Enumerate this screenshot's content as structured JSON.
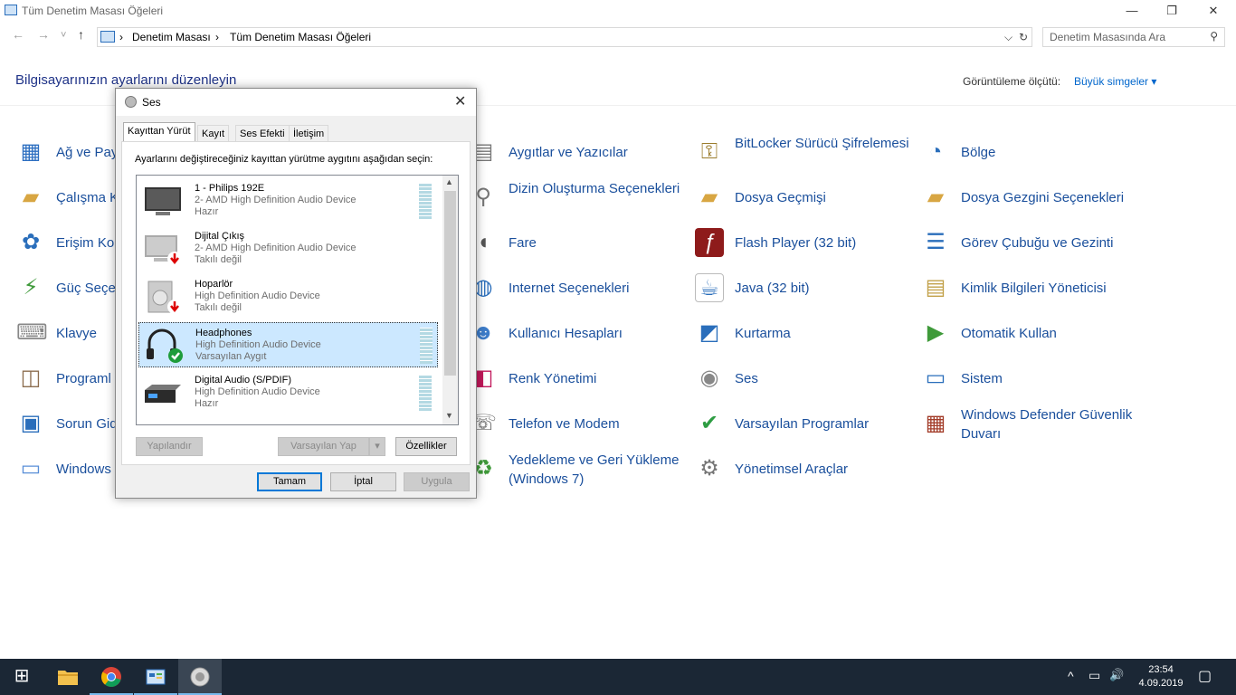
{
  "window": {
    "title": "Tüm Denetim Masası Öğeleri",
    "minimize": "—",
    "maximize": "❐",
    "close": "✕"
  },
  "nav": {
    "back": "←",
    "forward": "→",
    "recent": "˅",
    "up": "↑"
  },
  "address": {
    "sep": "›",
    "crumb1": "Denetim Masası",
    "crumb2": "Tüm Denetim Masası Öğeleri",
    "dropdown": "⌵",
    "refresh": "↻"
  },
  "search": {
    "placeholder": "Denetim Masasında Ara",
    "icon": "⚲"
  },
  "header": {
    "title": "Bilgisayarınızın ayarlarını düzenleyin",
    "view_by_label": "Görüntüleme ölçütü:",
    "view_by_value": "Büyük simgeler ▾"
  },
  "items": [
    {
      "label": "Ağ ve Pay",
      "icon": "network-icon",
      "glyph": "▦",
      "color": "#2d6fc1"
    },
    {
      "label": "Çalışma K",
      "icon": "work-folders-icon",
      "glyph": "▰",
      "color": "#d8a642"
    },
    {
      "label": "Erişim Ko",
      "icon": "ease-of-access-icon",
      "glyph": "✿",
      "color": "#2a6ebb"
    },
    {
      "label": "Güç Seçen",
      "icon": "power-options-icon",
      "glyph": "⚡",
      "color": "#3f9a3a"
    },
    {
      "label": "Klavye",
      "icon": "keyboard-icon",
      "glyph": "⌨",
      "color": "#888888"
    },
    {
      "label": "Programl",
      "icon": "programs-icon",
      "glyph": "◫",
      "color": "#8c6d4f"
    },
    {
      "label": "Sorun Gid",
      "icon": "troubleshooting-icon",
      "glyph": "▣",
      "color": "#2a6ebb"
    },
    {
      "label": "Windows",
      "icon": "windows-to-go-icon",
      "glyph": "▭",
      "color": "#5a8fd8"
    },
    {
      "label": "Aygıtlar ve Yazıcılar",
      "icon": "devices-printers-icon",
      "glyph": "▤",
      "color": "#777777"
    },
    {
      "label": "Dizin Oluşturma Seçenekleri",
      "icon": "indexing-icon",
      "glyph": "⚲",
      "color": "#777777"
    },
    {
      "label": "Fare",
      "icon": "mouse-icon",
      "glyph": "◖",
      "color": "#555555"
    },
    {
      "label": "Internet Seçenekleri",
      "icon": "internet-options-icon",
      "glyph": "◍",
      "color": "#2a6ebb"
    },
    {
      "label": "Kullanıcı Hesapları",
      "icon": "user-accounts-icon",
      "glyph": "☻",
      "color": "#3d7cc9"
    },
    {
      "label": "Renk Yönetimi",
      "icon": "color-management-icon",
      "glyph": "◧",
      "color": "#c2185b"
    },
    {
      "label": "Telefon ve Modem",
      "icon": "phone-modem-icon",
      "glyph": "☏",
      "color": "#666666"
    },
    {
      "label": "Yedekleme ve Geri Yükleme (Windows 7)",
      "icon": "backup-restore-icon",
      "glyph": "♻",
      "color": "#3f9a3a"
    },
    {
      "label": "BitLocker Sürücü Şifrelemesi",
      "icon": "bitlocker-icon",
      "glyph": "⚿",
      "color": "#9a7b2a"
    },
    {
      "label": "Dosya Geçmişi",
      "icon": "file-history-icon",
      "glyph": "▰",
      "color": "#d8a642"
    },
    {
      "label": "Flash Player (32 bit)",
      "icon": "flash-player-icon",
      "glyph": "ƒ",
      "color": "#8e1b1b"
    },
    {
      "label": "Java (32 bit)",
      "icon": "java-icon",
      "glyph": "☕",
      "color": "#2a6ebb"
    },
    {
      "label": "Kurtarma",
      "icon": "recovery-icon",
      "glyph": "◩",
      "color": "#2a6ebb"
    },
    {
      "label": "Ses",
      "icon": "sound-icon",
      "glyph": "◉",
      "color": "#888888"
    },
    {
      "label": "Varsayılan Programlar",
      "icon": "default-programs-icon",
      "glyph": "✔",
      "color": "#2e9d43"
    },
    {
      "label": "Yönetimsel Araçlar",
      "icon": "administrative-tools-icon",
      "glyph": "⚙",
      "color": "#777777"
    },
    {
      "label": "Bölge",
      "icon": "region-icon",
      "glyph": "◔",
      "color": "#2a6ebb"
    },
    {
      "label": "Dosya Gezgini Seçenekleri",
      "icon": "file-explorer-options-icon",
      "glyph": "▰",
      "color": "#d8a642"
    },
    {
      "label": "Görev Çubuğu ve Gezinti",
      "icon": "taskbar-navigation-icon",
      "glyph": "☰",
      "color": "#2a6ebb"
    },
    {
      "label": "Kimlik Bilgileri Yöneticisi",
      "icon": "credential-manager-icon",
      "glyph": "▤",
      "color": "#c2a14a"
    },
    {
      "label": "Otomatik Kullan",
      "icon": "autoplay-icon",
      "glyph": "▶",
      "color": "#3f9a3a"
    },
    {
      "label": "Sistem",
      "icon": "system-icon",
      "glyph": "▭",
      "color": "#2a6ebb"
    },
    {
      "label": "Windows Defender Güvenlik Duvarı",
      "icon": "firewall-icon",
      "glyph": "▦",
      "color": "#a33d2a"
    }
  ],
  "dialog": {
    "title": "Ses",
    "close": "✕",
    "tabs": [
      "Kayıttan Yürüt",
      "Kayıt",
      "Ses Efekti",
      "İletişim"
    ],
    "instruction": "Ayarlarını değiştireceğiniz kayıttan yürütme aygıtını aşağıdan seçin:",
    "devices": [
      {
        "name": "1 - Philips 192E",
        "desc": "2- AMD High Definition Audio Device",
        "status": "Hazır"
      },
      {
        "name": "Dijital Çıkış",
        "desc": "2- AMD High Definition Audio Device",
        "status": "Takılı değil"
      },
      {
        "name": "Hoparlör",
        "desc": "High Definition Audio Device",
        "status": "Takılı değil"
      },
      {
        "name": "Headphones",
        "desc": "High Definition Audio Device",
        "status": "Varsayılan Aygıt"
      },
      {
        "name": "Digital Audio (S/PDIF)",
        "desc": "High Definition Audio Device",
        "status": "Hazır"
      }
    ],
    "scroll_up": "▲",
    "scroll_down": "▼",
    "configure": "Yapılandır",
    "set_default": "Varsayılan Yap",
    "set_default_arrow": "▾",
    "properties": "Özellikler",
    "ok": "Tamam",
    "cancel": "İptal",
    "apply": "Uygula"
  },
  "taskbar": {
    "start": "⊞",
    "tray_up": "^",
    "network": "▭",
    "volume": "🔊",
    "time": "23:54",
    "date": "4.09.2019",
    "notifications": "▢"
  }
}
